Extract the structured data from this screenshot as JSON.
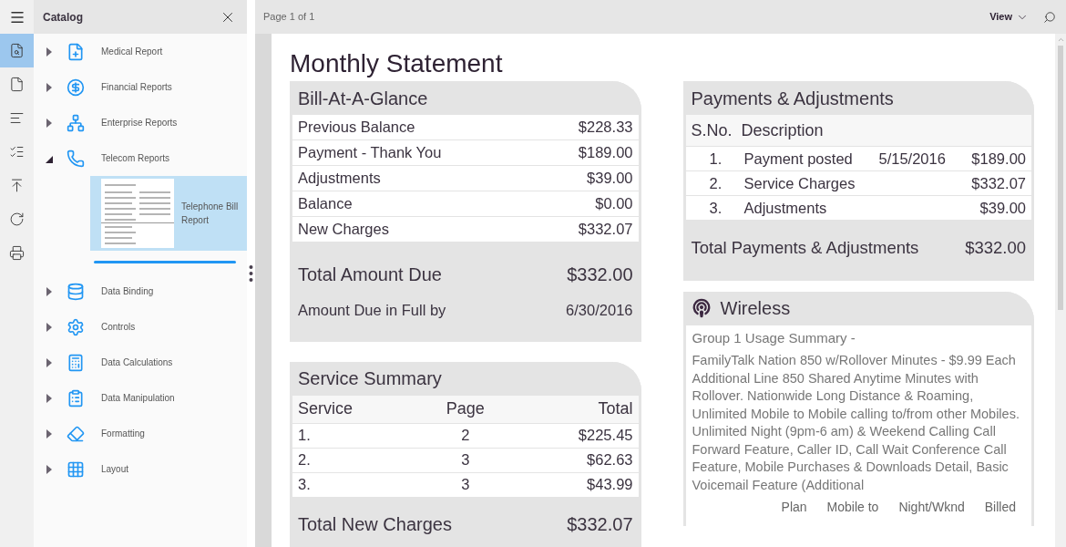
{
  "rail": [
    {
      "selected": true
    },
    {
      "selected": false
    },
    {
      "selected": false
    },
    {
      "selected": false
    },
    {
      "selected": false
    },
    {
      "selected": false
    },
    {
      "selected": false
    }
  ],
  "catalog": {
    "title": "Catalog",
    "items": [
      {
        "label": "Medical Report",
        "expanded": false
      },
      {
        "label": "Financial Reports",
        "expanded": false
      },
      {
        "label": "Enterprise Reports",
        "expanded": false
      },
      {
        "label": "Telecom Reports",
        "expanded": true,
        "children": [
          {
            "label": "Telephone Bill Report",
            "selected": true
          }
        ]
      },
      {
        "label": "Data Binding",
        "expanded": false
      },
      {
        "label": "Controls",
        "expanded": false
      },
      {
        "label": "Data Calculations",
        "expanded": false
      },
      {
        "label": "Data Manipulation",
        "expanded": false
      },
      {
        "label": "Formatting",
        "expanded": false
      },
      {
        "label": "Layout",
        "expanded": false
      }
    ]
  },
  "toolbar": {
    "page_indicator": "Page 1 of 1",
    "view_button": "View"
  },
  "statement": {
    "title": "Monthly Statement",
    "bill_at_a_glance": {
      "title": "Bill-At-A-Glance",
      "rows": [
        {
          "label": "Previous Balance",
          "value": "$228.33"
        },
        {
          "label": "Payment - Thank You",
          "value": "$189.00"
        },
        {
          "label": "Adjustments",
          "value": "$39.00"
        },
        {
          "label": "Balance",
          "value": "$0.00"
        },
        {
          "label": "New Charges",
          "value": "$332.07"
        }
      ],
      "total_label": "Total Amount Due",
      "total_value": "$332.00",
      "due_label": "Amount Due in Full by",
      "due_value": "6/30/2016"
    },
    "service_summary": {
      "title": "Service Summary",
      "columns": [
        "Service",
        "Page",
        "Total"
      ],
      "rows": [
        [
          "1.",
          "2",
          "$225.45"
        ],
        [
          "2.",
          "3",
          "$62.63"
        ],
        [
          "3.",
          "3",
          "$43.99"
        ]
      ],
      "total_label": "Total New Charges",
      "total_value": "$332.07"
    },
    "payments": {
      "title": "Payments & Adjustments",
      "columns": [
        "S.No.",
        "Description"
      ],
      "rows": [
        {
          "no": "1.",
          "description": "Payment posted",
          "date": "5/15/2016",
          "amount": "$189.00"
        },
        {
          "no": "2.",
          "description": "Service Charges",
          "amount": "$332.07"
        },
        {
          "no": "3.",
          "description": "Adjustments",
          "amount": "$39.00"
        }
      ],
      "total_label": "Total Payments & Adjustments",
      "total_value": "$332.00"
    },
    "wireless": {
      "title": "Wireless",
      "subtitle": "Group 1 Usage Summary -",
      "description": "FamilyTalk Nation 850 w/Rollover Minutes - $9.99 Each Additional Line 850 Shared Anytime Minutes with Rollover. Nationwide Long Distance & Roaming, Unlimited Mobile to Mobile calling to/from other Mobiles. Unlimited Night (9pm-6 am) & Weekend Calling Call Forward Feature, Caller ID, Call Wait Conference Call Feature, Mobile Purchases & Downloads Detail, Basic Voicemail Feature (Additional",
      "columns": [
        "Plan",
        "Mobile to",
        "Night/Wknd",
        "Billed"
      ]
    }
  }
}
